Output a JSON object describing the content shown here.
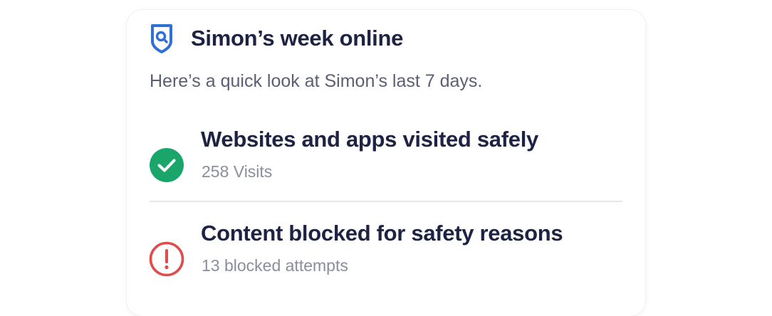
{
  "card": {
    "title": "Simon’s week online",
    "subtitle": "Here’s a quick look at Simon’s last 7 days.",
    "stats": [
      {
        "title": "Websites and apps visited safely",
        "detail": "258 Visits",
        "icon": "check-circle-icon",
        "color": "#1aa56b"
      },
      {
        "title": "Content blocked for safety reasons",
        "detail": "13 blocked attempts",
        "icon": "alert-circle-icon",
        "color": "#e04b4b"
      }
    ]
  },
  "colors": {
    "accent": "#2f6fd6",
    "text_primary": "#1e2344",
    "text_secondary": "#5b5f73",
    "text_muted": "#8a8e9c"
  }
}
